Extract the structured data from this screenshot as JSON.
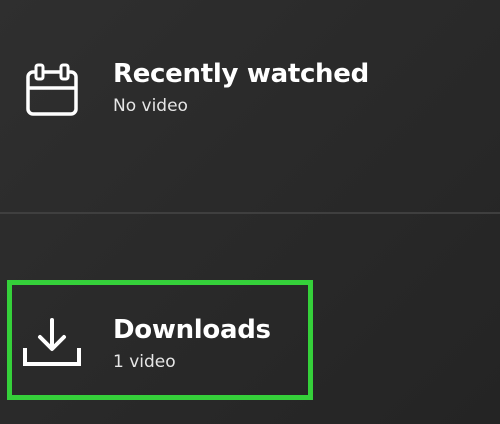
{
  "menu": {
    "items": [
      {
        "icon": "calendar-icon",
        "title": "Recently watched",
        "subtitle": "No video"
      },
      {
        "icon": "download-icon",
        "title": "Downloads",
        "subtitle": "1 video"
      }
    ]
  },
  "colors": {
    "background": "#2a2a2a",
    "divider": "#3f3f3f",
    "highlight": "#35d03a",
    "text": "#ffffff"
  }
}
